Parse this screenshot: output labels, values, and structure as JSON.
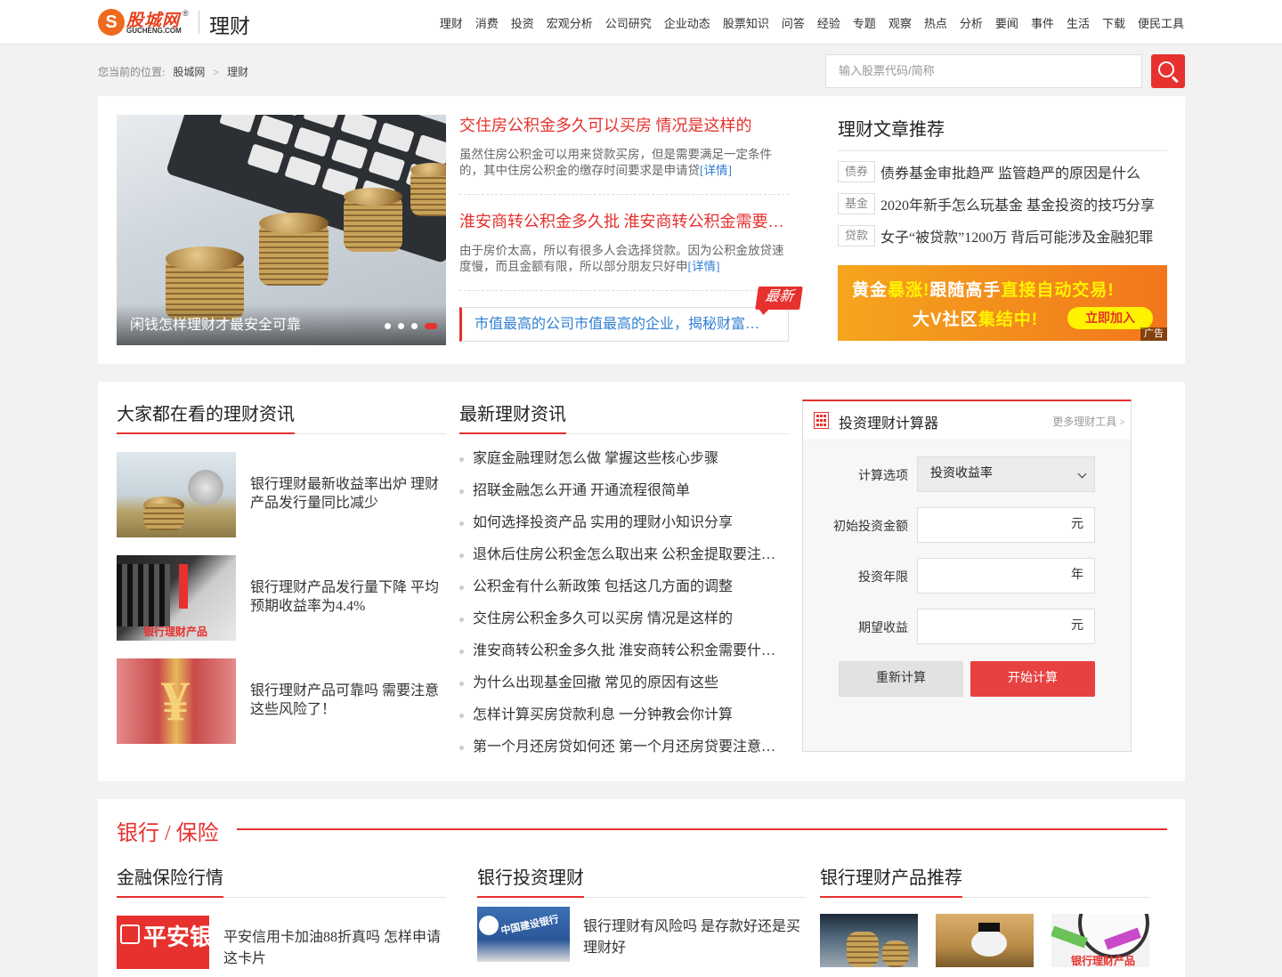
{
  "header": {
    "logo_text": "股城网",
    "logo_sub": "GUCHENG.COM",
    "logo_reg": "®",
    "section_title": "理财",
    "nav": [
      "理财",
      "消费",
      "投资",
      "宏观分析",
      "公司研究",
      "企业动态",
      "股票知识",
      "问答",
      "经验",
      "专题",
      "观察",
      "热点",
      "分析",
      "要闻",
      "事件",
      "生活",
      "下载",
      "便民工具"
    ]
  },
  "breadcrumb": {
    "prefix": "您当前的位置:",
    "home": "股城网",
    "sep": ">",
    "current": "理财"
  },
  "search": {
    "placeholder": "输入股票代码/简称"
  },
  "slider": {
    "caption": "闲钱怎样理财才最安全可靠",
    "dots": 4,
    "active_dot": 4
  },
  "featured": [
    {
      "title": "交住房公积金多久可以买房 情况是这样的",
      "desc": "虽然住房公积金可以用来贷款买房，但是需要满足一定条件的，其中住房公积金的缴存时间要求是申请贷",
      "more": "[详情]"
    },
    {
      "title": "淮安商转公积金多久批 淮安商转公积金需要什么材料",
      "desc": "由于房价太高，所以有很多人会选择贷款。因为公积金放贷速度慢，而且金额有限，所以部分朋友只好申",
      "more": "[详情]"
    }
  ],
  "latest": {
    "tag": "最新",
    "text": "市值最高的公司市值最高的企业，揭秘财富巨头"
  },
  "recommend": {
    "title": "理财文章推荐",
    "items": [
      {
        "tag": "债券",
        "text": "债券基金审批趋严 监管趋严的原因是什么"
      },
      {
        "tag": "基金",
        "text": "2020年新手怎么玩基金 基金投资的技巧分享"
      },
      {
        "tag": "贷款",
        "text": "女子“被贷款”1200万 背后可能涉及金融犯罪"
      }
    ]
  },
  "ad": {
    "line1_a": "黄金",
    "line1_b": "暴涨!",
    "line1_c": "跟随高手",
    "line1_d": "直接自动交易!",
    "line2_a": "大V社区",
    "line2_b": "集结中!",
    "button": "立即加入",
    "tag": "广告"
  },
  "popular": {
    "title": "大家都在看的理财资讯",
    "items": [
      {
        "text": "银行理财最新收益率出炉 理财产品发行量同比减少"
      },
      {
        "text": "银行理财产品发行量下降 平均预期收益率为4.4%"
      },
      {
        "text": "银行理财产品可靠吗 需要注意这些风险了！"
      }
    ],
    "thumb2_label": "银行理财产品"
  },
  "news": {
    "title": "最新理财资讯",
    "items": [
      "家庭金融理财怎么做 掌握这些核心步骤",
      "招联金融怎么开通 开通流程很简单",
      "如何选择投资产品 实用的理财小知识分享",
      "退休后住房公积金怎么取出来 公积金提取要注意什么",
      "公积金有什么新政策 包括这几方面的调整",
      "交住房公积金多久可以买房 情况是这样的",
      "淮安商转公积金多久批 淮安商转公积金需要什么材料",
      "为什么出现基金回撤 常见的原因有这些",
      "怎样计算买房贷款利息 一分钟教会你计算",
      "第一个月还房贷如何还 第一个月还房贷要注意什么"
    ]
  },
  "calculator": {
    "title": "投资理财计算器",
    "more": "更多理财工具 >",
    "option_label": "计算选项",
    "option_value": "投资收益率",
    "fields": [
      {
        "label": "初始投资金额",
        "unit": "元"
      },
      {
        "label": "投资年限",
        "unit": "年"
      },
      {
        "label": "期望收益",
        "unit": "元"
      }
    ],
    "reset": "重新计算",
    "start": "开始计算"
  },
  "bank": {
    "title": "银行 / 保险",
    "cols": [
      {
        "title": "金融保险行情",
        "item": "平安信用卡加油88折真吗 怎样申请这卡片",
        "thumb_label": "平安银行"
      },
      {
        "title": "银行投资理财",
        "item": "银行理财有风险吗 是存款好还是买理财好",
        "thumb_label": "中国建设银行"
      },
      {
        "title": "银行理财产品推荐",
        "thumb_label": "银行理财产品"
      }
    ]
  },
  "colors": {
    "accent": "#e6312e",
    "link": "#2f7fd2",
    "ad_orange": "#f38e1c"
  }
}
